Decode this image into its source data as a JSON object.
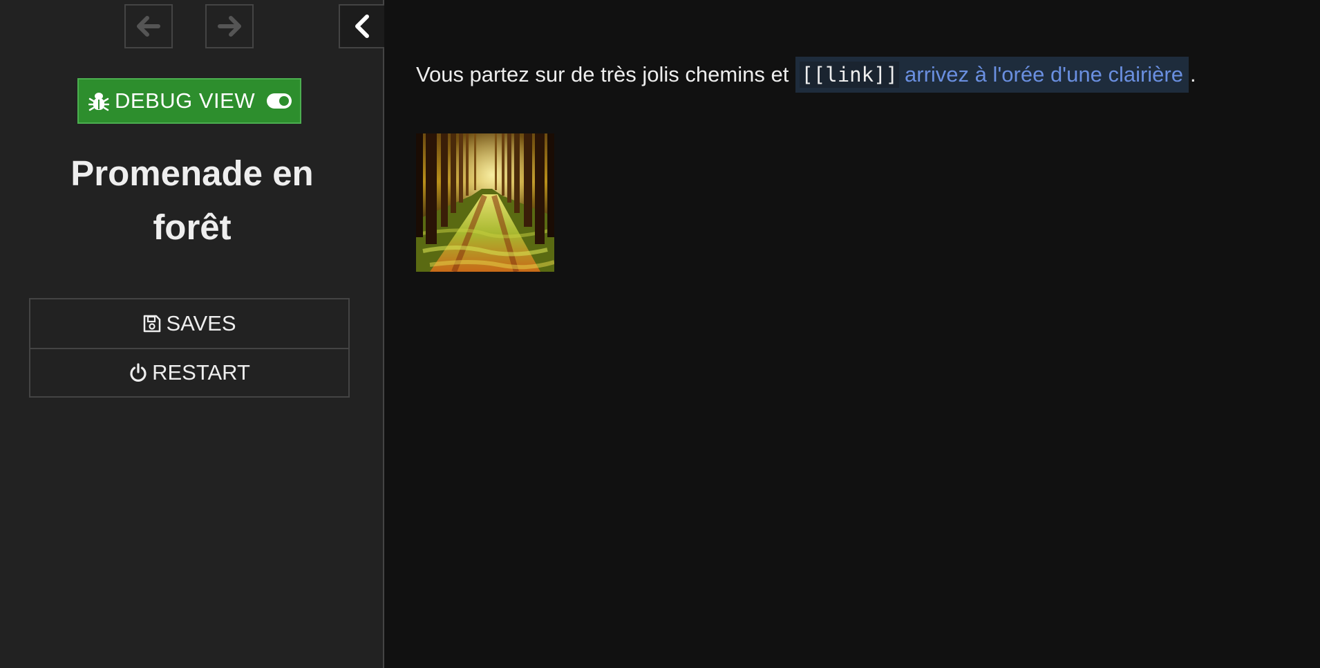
{
  "sidebar": {
    "history_back_icon": "arrow-left-icon",
    "history_forward_icon": "arrow-right-icon",
    "toggle_icon": "chevron-left-icon",
    "debug": {
      "icon": "bug-icon",
      "label": "DEBUG VIEW",
      "switch_icon": "toggle-on-icon",
      "enabled": true,
      "color": "#2d8e2d"
    },
    "story_title_line1": "Promenade en",
    "story_title_line2": "forêt",
    "menu": [
      {
        "label": "SAVES",
        "icon": "floppy-disk-icon"
      },
      {
        "label": "RESTART",
        "icon": "power-icon"
      }
    ]
  },
  "passage": {
    "text_before": "Vous partez sur de très jolis chemins et",
    "debug_macro": "[[link]]",
    "link_text": "arrivez à l'orée d'une clairière",
    "text_after": ".",
    "link_color": "#6a8fe0",
    "image_subject": "forest-path-image"
  }
}
